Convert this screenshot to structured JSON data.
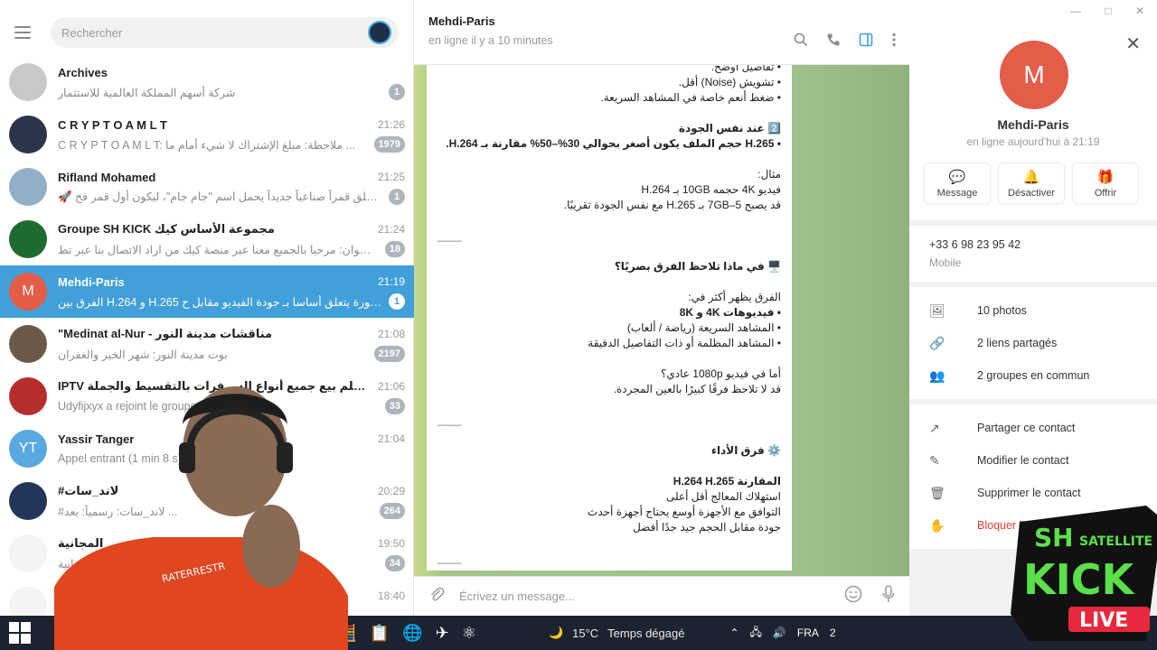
{
  "window": {
    "controls": [
      "—",
      "□",
      "✕"
    ]
  },
  "left": {
    "search_placeholder": "Rechercher",
    "chats": [
      {
        "name": "Archives",
        "time": "",
        "preview": "شركة أسهم المملكة العالمية للاستثمار",
        "badge": "1",
        "avatar_color": "#c9c9c9",
        "avatar_text": ""
      },
      {
        "name": "C R Y P T O A M L T",
        "time": "21:26",
        "preview": "C R Y P T O A M L T: ملاحظة: مبلغ الإشتراك لا شيء أمام ما ...",
        "badge": "1979",
        "avatar_color": "#2b3448",
        "avatar_text": ""
      },
      {
        "name": "Rifland Mohamed",
        "time": "21:25",
        "preview": "🚀 إيران تُطلق قمراً صناعياً جديداً يحمل اسم \"جام جام\"، ليكون أول قمر فخ...",
        "badge": "1",
        "avatar_color": "#8fb0c8",
        "avatar_text": ""
      },
      {
        "name": "Groupe SH KICK مجموعة الأساس كيك",
        "time": "21:24",
        "preview": "رضوان: مرحبا بالجميع معنا عبر منصة كيك من اراد الاتصال بنا عبر تط...",
        "badge": "18",
        "avatar_color": "#1d6b2f",
        "avatar_text": ""
      },
      {
        "name": "Mehdi-Paris",
        "time": "21:19",
        "preview": "الفرق بين H.264 و H.265 في الصورة يتعلق أساسا بـ جودة الفيديو مقابل ح...",
        "badge": "1",
        "avatar_color": "#e35d49",
        "avatar_text": "M"
      },
      {
        "name": "\"Medinat al-Nur - مناقشات مدينة النور",
        "time": "21:08",
        "preview": "بوت مدينة النور: شهر الخير والغفران",
        "badge": "2197",
        "avatar_color": "#6b5a4a",
        "avatar_text": ""
      },
      {
        "name": "IPTV نعلم وتتعلم بيع جميع أنواع السرفرات بالتقسيط والجملة",
        "time": "21:06",
        "preview": "Udyfijxyx a rejoint le groupe",
        "badge": "33",
        "avatar_color": "#b52d2d",
        "avatar_text": ""
      },
      {
        "name": "Yassir Tanger",
        "time": "21:04",
        "preview": "Appel entrant (1 min 8 s)",
        "badge": "",
        "avatar_color": "#5aa8e0",
        "avatar_text": "YT"
      },
      {
        "name": "#لاند_سات",
        "time": "20:29",
        "preview": "#لاند_سات: رسمياً: بعد ...",
        "badge": "264",
        "avatar_color": "#24355a",
        "avatar_text": ""
      },
      {
        "name": "المجانية",
        "time": "19:50",
        "preview": "سيرفرات المجانية",
        "badge": "34",
        "avatar_color": "#f4f4f4",
        "avatar_text": ""
      },
      {
        "name": "",
        "time": "18:40",
        "preview": "",
        "badge": "",
        "avatar_color": "#f4f4f4",
        "avatar_text": ""
      }
    ]
  },
  "header": {
    "title": "Mehdi-Paris",
    "status": "en ligne il y a 10 minutes"
  },
  "message": {
    "lines": [
      {
        "t": "• تفاصيل أوضح.",
        "b": false
      },
      {
        "t": "• تشويش (Noise) أقل.",
        "b": false
      },
      {
        "t": "• ضغط أنعم خاصة في المشاهد السريعة.",
        "b": false
      },
      {
        "t": "",
        "b": false
      },
      {
        "t": "2️⃣ عند نفس الجودة",
        "b": true
      },
      {
        "t": "• H.265 حجم الملف يكون أصغر بحوالي 30%–50% مقارنة بـ H.264.",
        "b": true
      },
      {
        "t": "",
        "b": false
      },
      {
        "t": "مثال:",
        "b": false
      },
      {
        "t": "فيديو 4K حجمه 10GB بـ H.264",
        "b": false
      },
      {
        "t": "قد يصبح 5–7GB بـ H.265 مع نفس الجودة تقريبًا.",
        "b": false
      },
      {
        "t": "",
        "b": false
      },
      {
        "t": "____",
        "b": false,
        "sep": true
      },
      {
        "t": "",
        "b": false
      },
      {
        "t": "🖥️ في ماذا تلاحظ الفرق بصريًا؟",
        "b": true
      },
      {
        "t": "",
        "b": false
      },
      {
        "t": "الفرق يظهر أكثر في:",
        "b": false
      },
      {
        "t": "• فيديوهات 4K و 8K",
        "b": true
      },
      {
        "t": "• المشاهد السريعة (رياضة / ألعاب)",
        "b": false
      },
      {
        "t": "• المشاهد المظلمة أو ذات التفاصيل الدقيقة",
        "b": false
      },
      {
        "t": "",
        "b": false
      },
      {
        "t": "أما في فيديو 1080p عادي؟",
        "b": false
      },
      {
        "t": "قد لا تلاحظ فرقًا كبيرًا بالعين المجردة.",
        "b": false
      },
      {
        "t": "",
        "b": false
      },
      {
        "t": "____",
        "b": false,
        "sep": true
      },
      {
        "t": "",
        "b": false
      },
      {
        "t": "⚙️ فرق الأداء",
        "b": true
      },
      {
        "t": "",
        "b": false
      },
      {
        "t": "المقارنة H.264 H.265",
        "b": true
      },
      {
        "t": "استهلاك المعالج أقل أعلى",
        "b": false
      },
      {
        "t": "التوافق مع الأجهزة أوسع يحتاج أجهزة أحدث",
        "b": false
      },
      {
        "t": "جودة مقابل الحجم جيد جدًا أفضل",
        "b": false
      },
      {
        "t": "",
        "b": false
      },
      {
        "t": "____",
        "b": false,
        "sep": true
      }
    ]
  },
  "composer": {
    "placeholder": "Écrivez un message..."
  },
  "profile": {
    "avatar": "M",
    "name": "Mehdi-Paris",
    "status": "en ligne aujourd'hui à 21:19",
    "actions": [
      {
        "label": "Message",
        "icon": "💬"
      },
      {
        "label": "Désactiver",
        "icon": "🔔"
      },
      {
        "label": "Offrir",
        "icon": "🎁"
      }
    ],
    "phone": "+33 6 98 23 95 42",
    "phone_label": "Mobile",
    "media": [
      {
        "label": "10 photos",
        "icon": "🖼"
      },
      {
        "label": "2 liens partagés",
        "icon": "🔗"
      },
      {
        "label": "2 groupes en commun",
        "icon": "👥"
      }
    ],
    "manage": [
      {
        "label": "Partager ce contact",
        "icon": "↗"
      },
      {
        "label": "Modifier le contact",
        "icon": "✎"
      },
      {
        "label": "Supprimer le contact",
        "icon": "🗑"
      },
      {
        "label": "Bloquer l'ut",
        "icon": "✋",
        "danger": true
      }
    ]
  },
  "taskbar": {
    "temperature": "15°C",
    "weather": "Temps dégagé",
    "lang": "FRA",
    "time": "2"
  },
  "logo": {
    "line1": "SH",
    "line2": "SATELLITE",
    "line3": "KICK",
    "line4": "LIVE"
  }
}
